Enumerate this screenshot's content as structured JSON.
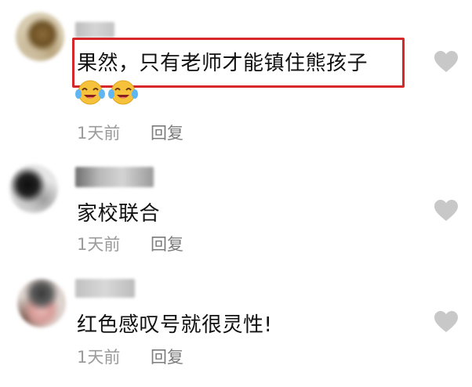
{
  "comments": [
    {
      "text": "果然，只有老师才能镇住熊孩子",
      "emoji": [
        "crying-laughing-emoji",
        "crying-laughing-emoji"
      ],
      "time": "1天前",
      "reply_label": "回复"
    },
    {
      "text": "家校联合",
      "time": "1天前",
      "reply_label": "回复"
    },
    {
      "text": "红色感叹号就很灵性!",
      "time": "1天前",
      "reply_label": "回复"
    }
  ],
  "colors": {
    "highlight_border": "#d6282b",
    "like_icon": "#c8c8c8",
    "meta_text": "#9b9b9b"
  },
  "icons": {
    "like": "heart-icon",
    "emoji": "crying-laughing-emoji"
  }
}
